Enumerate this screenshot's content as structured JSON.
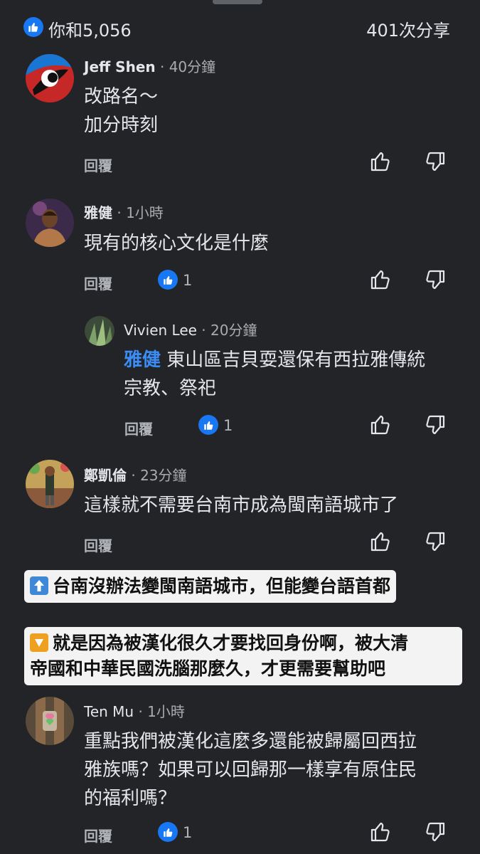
{
  "header": {
    "reactions": "你和5,056",
    "shares": "401次分享"
  },
  "labels": {
    "reply": "回覆"
  },
  "comments": [
    {
      "name": "Jeff Shen",
      "time": " · 40分鐘",
      "lines": [
        "改路名～",
        "加分時刻"
      ]
    },
    {
      "name": "雅健",
      "time": " · 1小時",
      "lines": [
        "現有的核心文化是什麼"
      ],
      "reactions": "1"
    },
    {
      "name": "Vivien Lee",
      "time": " · 20分鐘",
      "mention": "雅健",
      "lines": [
        " 東山區吉貝耍還保有西拉雅傳統",
        "宗教、祭祀"
      ],
      "reactions": "1"
    },
    {
      "name": "鄭凱倫",
      "time": " · 23分鐘",
      "lines": [
        "這樣就不需要台南市成為閩南語城市了"
      ]
    },
    {
      "name": "Ten Mu",
      "time": " · 1小時",
      "lines": [
        "重點我們被漢化這麼多還能被歸屬回西拉",
        "雅族嗎？如果可以回歸那一樣享有原住民",
        "的福利嗎？"
      ],
      "reactions": "1"
    }
  ],
  "overlay": {
    "line1": "台南沒辦法變閩南語城市，但能變台語首都",
    "line2": "就是因為被漢化很久才要找回身份啊，被大清",
    "line3": "帝國和中華民國洗腦那麼久，才更需要幫助吧"
  },
  "colors": {
    "background": "#232427",
    "accent": "#1877f2",
    "mention": "#3b8cf5",
    "overlay_bg": "#f3f3f3"
  },
  "icons": [
    "like-icon",
    "thumbs-up-outline-icon",
    "thumbs-down-outline-icon",
    "arrow-up-emoji-icon",
    "arrow-down-emoji-icon"
  ]
}
